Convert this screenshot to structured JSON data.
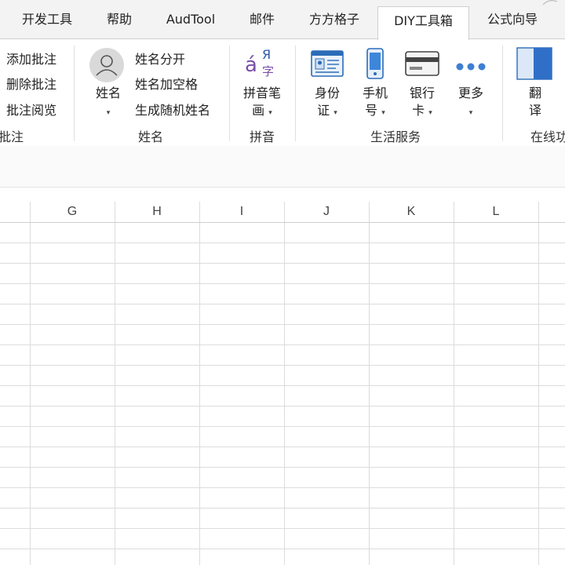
{
  "tabs": [
    {
      "label": "开发工具"
    },
    {
      "label": "帮助"
    },
    {
      "label": "AudTool"
    },
    {
      "label": "邮件"
    },
    {
      "label": "方方格子"
    },
    {
      "label": "DIY工具箱",
      "active": true
    },
    {
      "label": "公式向导"
    }
  ],
  "ribbon": {
    "comments_group": {
      "items": [
        "添加批注",
        "删除批注",
        "批注阅览"
      ],
      "label": "批注"
    },
    "name_group": {
      "big_button": "姓名",
      "items": [
        "姓名分开",
        "姓名加空格",
        "生成随机姓名"
      ],
      "label": "姓名"
    },
    "pinyin_group": {
      "button_line1": "拼音笔",
      "button_line2": "画",
      "label": "拼音",
      "icon_letters": {
        "a": "á",
        "ya": "Я",
        "zi": "字"
      }
    },
    "life_group": {
      "buttons": [
        {
          "line1": "身份",
          "line2": "证",
          "icon": "id-card-icon"
        },
        {
          "line1": "手机",
          "line2": "号",
          "icon": "mobile-phone-icon"
        },
        {
          "line1": "银行",
          "line2": "卡",
          "icon": "bank-card-icon"
        },
        {
          "line1": "更多",
          "line2": "",
          "icon": "more-dots-icon"
        }
      ],
      "label": "生活服务"
    },
    "online_group": {
      "button_line1": "翻",
      "button_line2": "译",
      "label": "在线功"
    }
  },
  "grid": {
    "columns": [
      "G",
      "H",
      "I",
      "J",
      "K",
      "L"
    ]
  },
  "colors": {
    "accent": "#1f6fd0",
    "grid_line": "#dcdcdc",
    "tab_bar": "#f3f3f3"
  }
}
